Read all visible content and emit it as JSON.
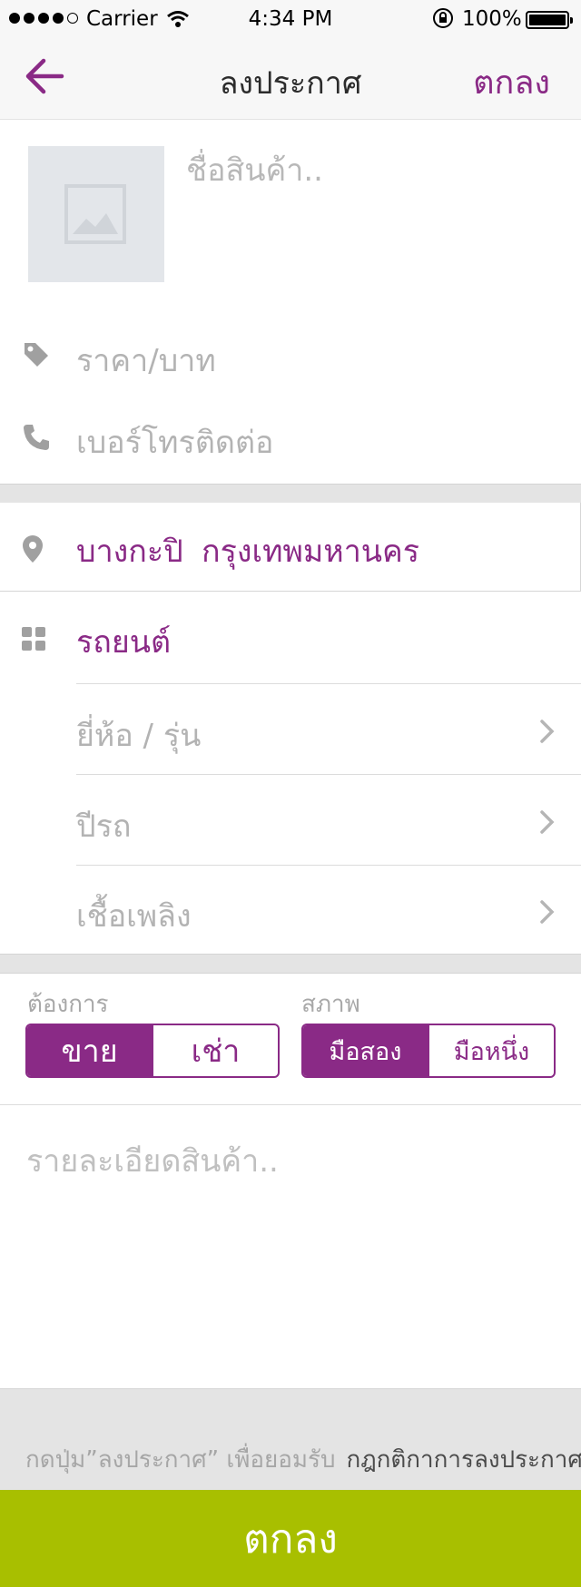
{
  "status_bar": {
    "carrier": "Carrier",
    "time": "4:34 PM",
    "battery": "100%"
  },
  "nav": {
    "title": "ลงประกาศ",
    "done_label": "ตกลง"
  },
  "product": {
    "name_placeholder": "ชื่อสินค้า..",
    "price_placeholder": "ราคา/บาท",
    "phone_placeholder": "เบอร์โทรติดต่อ"
  },
  "location": {
    "district": "บางกะปิ",
    "province": "กรุงเทพมหานคร"
  },
  "category": {
    "label": "รถยนต์",
    "fields": [
      {
        "label": "ยี่ห้อ / รุ่น"
      },
      {
        "label": "ปีรถ"
      },
      {
        "label": "เชื้อเพลิง"
      }
    ]
  },
  "want": {
    "label": "ต้องการ",
    "options": [
      "ขาย",
      "เช่า"
    ],
    "selected": "ขาย"
  },
  "condition": {
    "label": "สภาพ",
    "options": [
      "มือสอง",
      "มือหนึ่ง"
    ],
    "selected": "มือสอง"
  },
  "details_placeholder": "รายละเอียดสินค้า..",
  "terms": {
    "text": "กดปุ่ม”ลงประกาศ” เพื่อยอมรับ",
    "link": "กฎกติกาการลงประกาศ"
  },
  "submit_label": "ตกลง",
  "colors": {
    "accent": "#8a2a86",
    "submit": "#a8bf00"
  }
}
